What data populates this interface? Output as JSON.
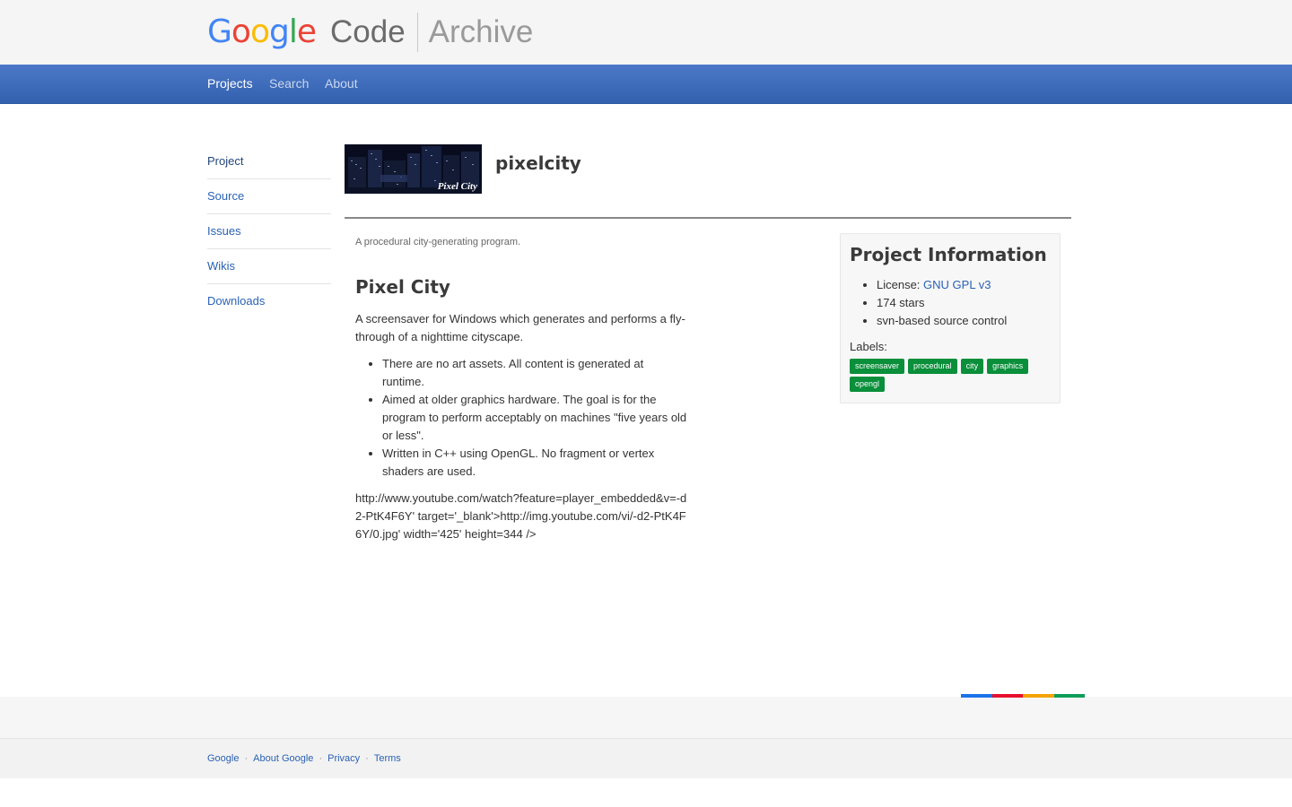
{
  "brand": {
    "google_letters": [
      {
        "char": "G",
        "color": "#4285f4"
      },
      {
        "char": "o",
        "color": "#ea4335"
      },
      {
        "char": "o",
        "color": "#fbbc05"
      },
      {
        "char": "g",
        "color": "#4285f4"
      },
      {
        "char": "l",
        "color": "#34a853"
      },
      {
        "char": "e",
        "color": "#ea4335"
      }
    ],
    "code": "Code",
    "archive": "Archive"
  },
  "nav": {
    "projects": "Projects",
    "search": "Search",
    "about": "About",
    "active": "Projects"
  },
  "sidebar": {
    "items": [
      {
        "label": "Project"
      },
      {
        "label": "Source"
      },
      {
        "label": "Issues"
      },
      {
        "label": "Wikis"
      },
      {
        "label": "Downloads"
      }
    ],
    "active": "Project"
  },
  "project": {
    "logo_text": "Pixel City",
    "name": "pixelcity",
    "summary": "A procedural city-generating program.",
    "heading": "Pixel City",
    "description": "A screensaver for Windows which generates and performs a fly-through of a nighttime cityscape.",
    "bullets": [
      "There are no art assets. All content is generated at runtime.",
      "Aimed at older graphics hardware. The goal is for the program to perform acceptably on machines \"five years old or less\".",
      "Written in C++ using OpenGL. No fragment or vertex shaders are used."
    ],
    "youtube_text": "http://www.youtube.com/watch?feature=player_embedded&v=-d2-PtK4F6Y' target='_blank'>http://img.youtube.com/vi/-d2-PtK4F6Y/0.jpg' width='425' height=344 />"
  },
  "info": {
    "title": "Project Information",
    "license_prefix": "License: ",
    "license_link": "GNU GPL v3",
    "stars": "174 stars",
    "source_control": "svn-based source control",
    "labels_title": "Labels:",
    "labels": [
      "screensaver",
      "procedural",
      "city",
      "graphics",
      "opengl"
    ],
    "label_color": "#0a8f3a"
  },
  "footer": {
    "links": [
      "Google",
      "About Google",
      "Privacy",
      "Terms"
    ],
    "separator": "·",
    "accent_colors": [
      "#1a73e8",
      "#e8102e",
      "#f4a300",
      "#0f9d58"
    ]
  },
  "colors": {
    "navbar": "#3f6dbc",
    "link": "#2a62b5"
  }
}
